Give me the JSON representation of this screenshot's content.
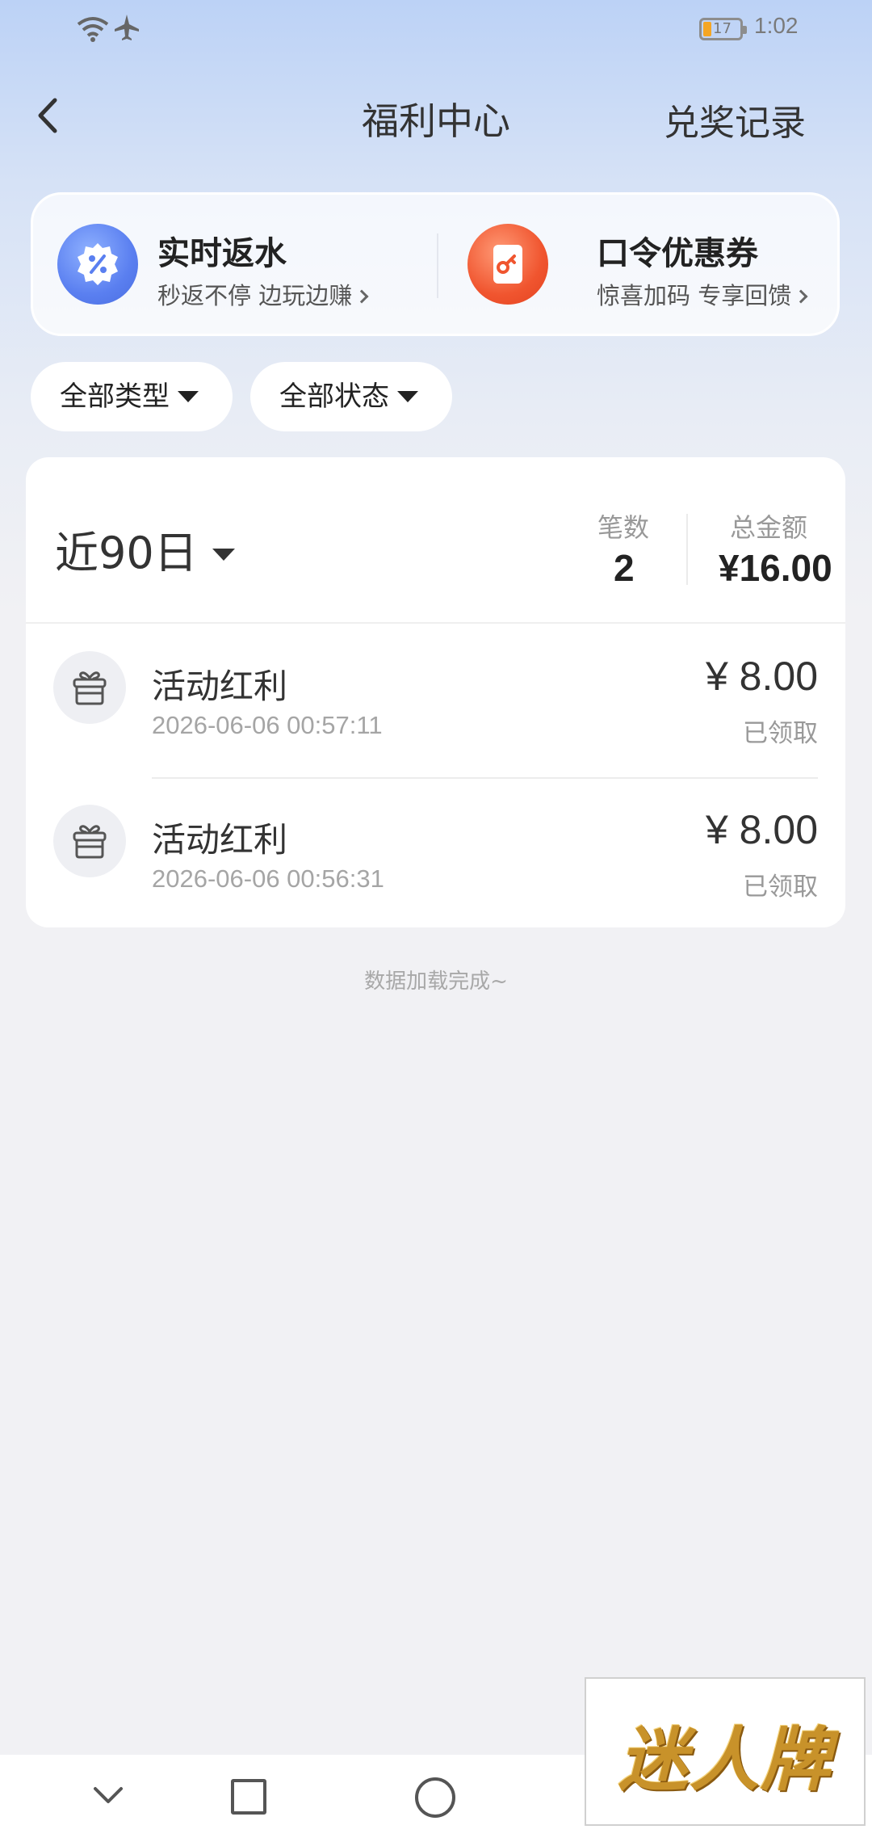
{
  "status_bar": {
    "battery": "17",
    "time": "1:02"
  },
  "nav": {
    "title": "福利中心",
    "right_action": "兑奖记录"
  },
  "promos": [
    {
      "title": "实时返水",
      "subtitle": "秒返不停 边玩边赚",
      "icon": "percent-badge-icon",
      "color": "#5a7ff0"
    },
    {
      "title": "口令优惠券",
      "subtitle": "惊喜加码 专享回馈",
      "icon": "key-coupon-icon",
      "color": "#f0552f"
    }
  ],
  "filters": {
    "type": "全部类型",
    "status": "全部状态"
  },
  "summary": {
    "period": "近90日",
    "count_label": "笔数",
    "count": "2",
    "total_label": "总金额",
    "total": "¥16.00"
  },
  "records": [
    {
      "title": "活动红利",
      "time": "2026-06-06 00:57:11",
      "amount": "¥ 8.00",
      "status": "已领取"
    },
    {
      "title": "活动红利",
      "time": "2026-06-06 00:56:31",
      "amount": "¥ 8.00",
      "status": "已领取"
    }
  ],
  "footer_note": "数据加载完成~",
  "watermark": "迷人牌"
}
